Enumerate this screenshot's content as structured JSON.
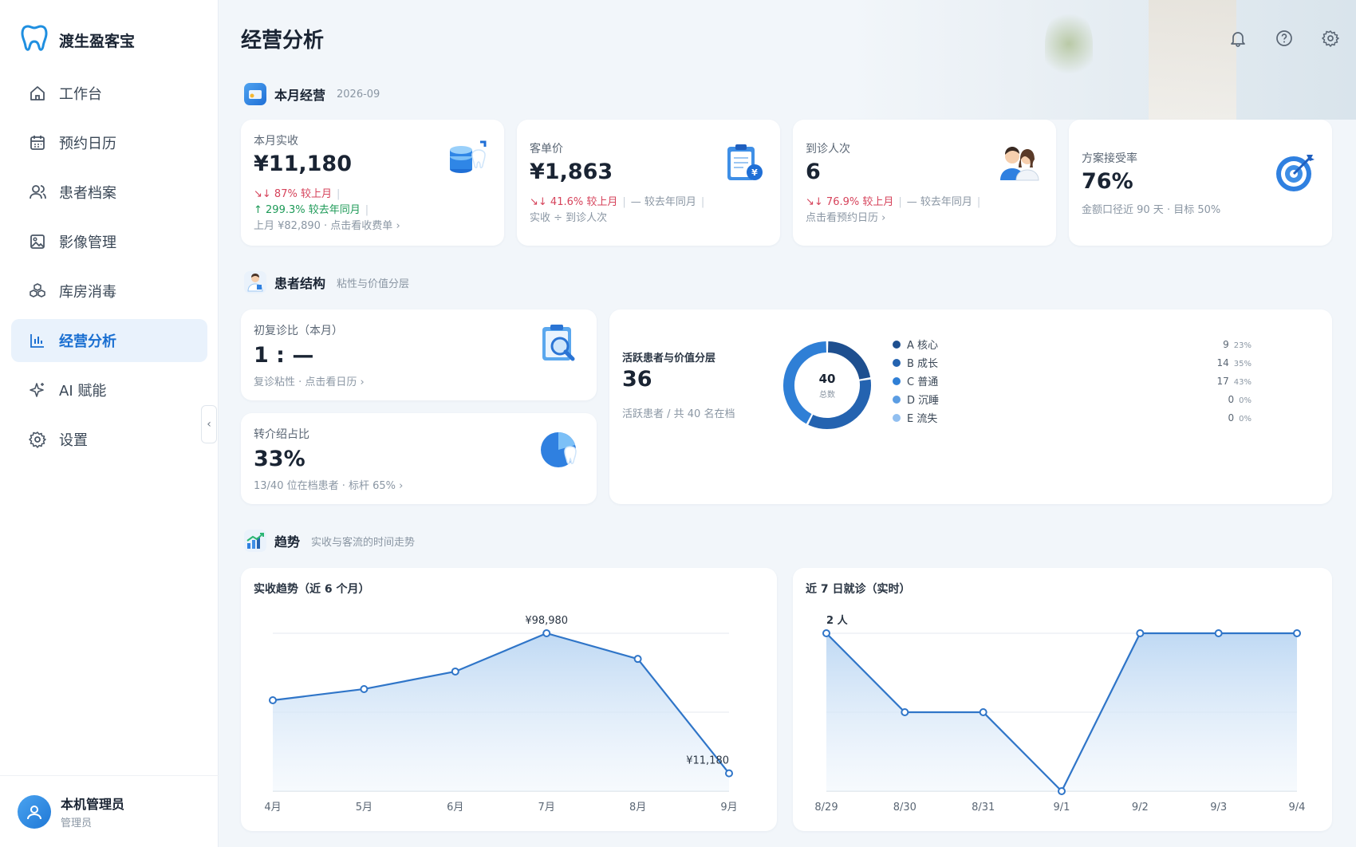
{
  "brand": {
    "title": "渡生盈客宝"
  },
  "sidebar": {
    "items": [
      {
        "label": "工作台",
        "icon": "home-icon",
        "active": false
      },
      {
        "label": "预约日历",
        "icon": "calendar-icon",
        "active": false
      },
      {
        "label": "患者档案",
        "icon": "users-icon",
        "active": false
      },
      {
        "label": "影像管理",
        "icon": "image-icon",
        "active": false
      },
      {
        "label": "库房消毒",
        "icon": "boxes-icon",
        "active": false
      },
      {
        "label": "经营分析",
        "icon": "bar-chart-icon",
        "active": true
      },
      {
        "label": "AI 赋能",
        "icon": "sparkle-icon",
        "active": false
      },
      {
        "label": "设置",
        "icon": "gear-icon",
        "active": false
      }
    ]
  },
  "user": {
    "name": "本机管理员",
    "role": "管理员"
  },
  "header": {
    "title": "经营分析"
  },
  "section_month": {
    "title": "本月经营",
    "sub": "2026-09"
  },
  "kpi": {
    "revenue": {
      "label": "本月实收",
      "value": "¥11,180",
      "mom": "↓ 87% 较上月",
      "yoy": "↑ 299.3% 较去年同月",
      "foot": "上月 ¥82,890 · 点击看收费单"
    },
    "avg": {
      "label": "客单价",
      "value": "¥1,863",
      "mom": "↓ 41.6% 较上月",
      "yoy": "— 较去年同月",
      "foot": "实收 ÷ 到诊人次"
    },
    "visits": {
      "label": "到诊人次",
      "value": "6",
      "mom": "↓ 76.9% 较上月",
      "yoy": "— 较去年同月",
      "foot": "点击看预约日历"
    },
    "accept": {
      "label": "方案接受率",
      "value": "76%",
      "foot": "金额口径近 90 天 · 目标 50%"
    }
  },
  "section_patient": {
    "title": "患者结构",
    "sub": "粘性与价值分层"
  },
  "ratio": {
    "label": "初复诊比（本月）",
    "value": "1 : —",
    "foot": "复诊粘性 · 点击看日历"
  },
  "referral": {
    "label": "转介绍占比",
    "value": "33%",
    "foot": "13/40 位在档患者 · 标杆 65%"
  },
  "active": {
    "label": "活跃患者与价值分层",
    "value": "36",
    "foot": "活跃患者 / 共 40 名在档",
    "donut_total": "40",
    "donut_label": "总数",
    "tiers": [
      {
        "name": "A 核心",
        "count": "9",
        "pct": "23%",
        "value": 9,
        "color": "#1e4f8f"
      },
      {
        "name": "B 成长",
        "count": "14",
        "pct": "35%",
        "value": 14,
        "color": "#2463b0"
      },
      {
        "name": "C 普通",
        "count": "17",
        "pct": "43%",
        "value": 17,
        "color": "#2f7fd6"
      },
      {
        "name": "D 沉睡",
        "count": "0",
        "pct": "0%",
        "value": 0,
        "color": "#5b9de3"
      },
      {
        "name": "E 流失",
        "count": "0",
        "pct": "0%",
        "value": 0,
        "color": "#91bff0"
      }
    ]
  },
  "section_trend": {
    "title": "趋势",
    "sub": "实收与客流的时间走势"
  },
  "chart_data": [
    {
      "type": "area",
      "title": "实收趋势（近 6 个月）",
      "categories": [
        "4月",
        "5月",
        "6月",
        "7月",
        "8月",
        "9月"
      ],
      "values": [
        57000,
        64000,
        75000,
        98980,
        82890,
        11180
      ],
      "ylim": [
        0,
        98980
      ],
      "annotations": [
        "¥98,980",
        "¥11,180"
      ]
    },
    {
      "type": "area",
      "title": "近 7 日就诊（实时）",
      "categories": [
        "8/29",
        "8/30",
        "8/31",
        "9/1",
        "9/2",
        "9/3",
        "9/4"
      ],
      "values": [
        2,
        1,
        1,
        0,
        2,
        2,
        2
      ],
      "ylim": [
        0,
        2
      ],
      "ymax_label": "2 人"
    }
  ]
}
